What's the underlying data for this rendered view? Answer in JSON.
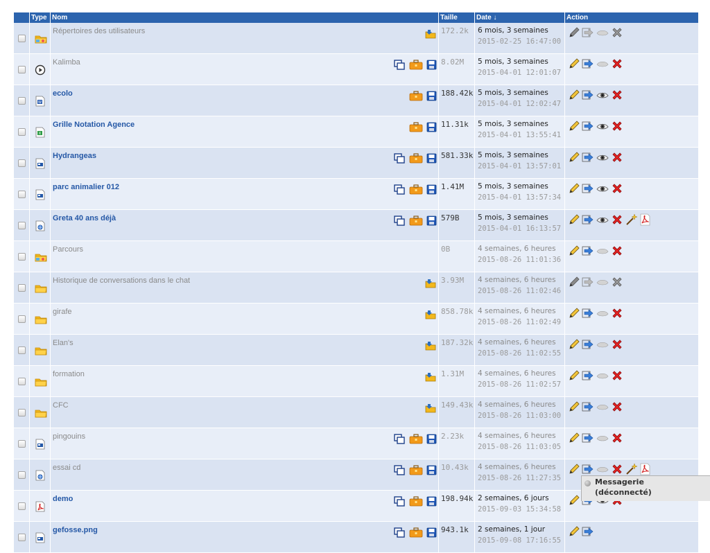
{
  "columns": {
    "type": "Type",
    "name": "Nom",
    "size": "Taille",
    "date": "Date ↓",
    "action": "Action"
  },
  "rows": [
    {
      "name": "Répertoires des utilisateurs",
      "type": "folder-shared",
      "size": "172.2k",
      "rel": "6 mois, 3 semaines",
      "abs": "2015-02-25 16:47:00",
      "style": "dim",
      "tools": [
        "move-icon"
      ],
      "actions": [
        "edit-icon",
        "forward-icon",
        "preview-icon",
        "delete-icon"
      ],
      "disabled": true
    },
    {
      "name": "Kalimba",
      "type": "audio",
      "size": "8.02M",
      "rel": "5 mois, 3 semaines",
      "abs": "2015-04-01 12:01:07",
      "style": "dim",
      "tools": [
        "copy-icon",
        "briefcase-icon",
        "save-icon"
      ],
      "actions": [
        "edit-icon",
        "forward-icon",
        "preview-icon",
        "delete-icon"
      ]
    },
    {
      "name": "ecolo",
      "type": "word",
      "size": "188.42k",
      "rel": "5 mois, 3 semaines",
      "abs": "2015-04-01 12:02:47",
      "style": "link",
      "tools": [
        "briefcase-icon",
        "save-icon"
      ],
      "actions": [
        "edit-icon",
        "forward-icon",
        "view-icon",
        "delete-icon"
      ]
    },
    {
      "name": "Grille Notation Agence",
      "type": "excel",
      "size": "11.31k",
      "rel": "5 mois, 3 semaines",
      "abs": "2015-04-01 13:55:41",
      "style": "link",
      "tools": [
        "briefcase-icon",
        "save-icon"
      ],
      "actions": [
        "edit-icon",
        "forward-icon",
        "view-icon",
        "delete-icon"
      ]
    },
    {
      "name": "Hydrangeas",
      "type": "image",
      "size": "581.33k",
      "rel": "5 mois, 3 semaines",
      "abs": "2015-04-01 13:57:01",
      "style": "link",
      "tools": [
        "copy-icon",
        "briefcase-icon",
        "save-icon"
      ],
      "actions": [
        "edit-icon",
        "forward-icon",
        "view-icon",
        "delete-icon"
      ]
    },
    {
      "name": "parc animalier 012",
      "type": "image",
      "size": "1.41M",
      "rel": "5 mois, 3 semaines",
      "abs": "2015-04-01 13:57:34",
      "style": "link",
      "tools": [
        "copy-icon",
        "briefcase-icon",
        "save-icon"
      ],
      "actions": [
        "edit-icon",
        "forward-icon",
        "view-icon",
        "delete-icon"
      ]
    },
    {
      "name": "Greta 40 ans déjà",
      "type": "web",
      "size": "579B",
      "rel": "5 mois, 3 semaines",
      "abs": "2015-04-01 16:13:57",
      "style": "link",
      "tools": [
        "copy-icon",
        "briefcase-icon",
        "save-icon"
      ],
      "actions": [
        "edit-icon",
        "forward-icon",
        "view-icon",
        "delete-icon",
        "wand-icon",
        "pdf-icon"
      ]
    },
    {
      "name": "Parcours",
      "type": "folder-shared",
      "size": "0B",
      "rel": "4 semaines, 6 heures",
      "abs": "2015-08-26 11:01:36",
      "style": "dim",
      "tools": [],
      "actions": [
        "edit-icon",
        "forward-icon",
        "preview-icon",
        "delete-icon"
      ],
      "dimDate": true
    },
    {
      "name": "Historique de conversations dans le chat",
      "type": "folder",
      "size": "3.93M",
      "rel": "4 semaines, 6 heures",
      "abs": "2015-08-26 11:02:46",
      "style": "dim",
      "tools": [
        "move-icon"
      ],
      "actions": [
        "edit-icon",
        "forward-icon",
        "preview-icon",
        "delete-icon"
      ],
      "disabled": true,
      "dimDate": true
    },
    {
      "name": "girafe",
      "type": "folder",
      "size": "858.78k",
      "rel": "4 semaines, 6 heures",
      "abs": "2015-08-26 11:02:49",
      "style": "dim",
      "tools": [
        "move-icon"
      ],
      "actions": [
        "edit-icon",
        "forward-icon",
        "preview-icon",
        "delete-icon"
      ],
      "dimDate": true
    },
    {
      "name": "Elan's",
      "type": "folder",
      "size": "187.32k",
      "rel": "4 semaines, 6 heures",
      "abs": "2015-08-26 11:02:55",
      "style": "dim",
      "tools": [
        "move-icon"
      ],
      "actions": [
        "edit-icon",
        "forward-icon",
        "preview-icon",
        "delete-icon"
      ],
      "dimDate": true
    },
    {
      "name": "formation",
      "type": "folder",
      "size": "1.31M",
      "rel": "4 semaines, 6 heures",
      "abs": "2015-08-26 11:02:57",
      "style": "dim",
      "tools": [
        "move-icon"
      ],
      "actions": [
        "edit-icon",
        "forward-icon",
        "preview-icon",
        "delete-icon"
      ],
      "dimDate": true
    },
    {
      "name": "CFC",
      "type": "folder",
      "size": "149.43k",
      "rel": "4 semaines, 6 heures",
      "abs": "2015-08-26 11:03:00",
      "style": "dim",
      "tools": [
        "move-icon"
      ],
      "actions": [
        "edit-icon",
        "forward-icon",
        "preview-icon",
        "delete-icon"
      ],
      "dimDate": true
    },
    {
      "name": "pingouins",
      "type": "image",
      "size": "2.23k",
      "rel": "4 semaines, 6 heures",
      "abs": "2015-08-26 11:03:05",
      "style": "dim",
      "tools": [
        "copy-icon",
        "briefcase-icon",
        "save-icon"
      ],
      "actions": [
        "edit-icon",
        "forward-icon",
        "preview-icon",
        "delete-icon"
      ],
      "dimDate": true
    },
    {
      "name": "essai cd",
      "type": "web",
      "size": "10.43k",
      "rel": "4 semaines, 6 heures",
      "abs": "2015-08-26 11:27:35",
      "style": "dim",
      "tools": [
        "copy-icon",
        "briefcase-icon",
        "save-icon"
      ],
      "actions": [
        "edit-icon",
        "forward-icon",
        "preview-icon",
        "delete-icon",
        "wand-icon",
        "pdf-icon"
      ],
      "dimDate": true
    },
    {
      "name": "demo",
      "type": "pdf",
      "size": "198.94k",
      "rel": "2 semaines, 6 jours",
      "abs": "2015-09-03 15:34:58",
      "style": "link",
      "tools": [
        "copy-icon",
        "briefcase-icon",
        "save-icon"
      ],
      "actions": [
        "edit-icon",
        "forward-icon",
        "view-icon",
        "delete-icon"
      ]
    },
    {
      "name": "gefosse.png",
      "type": "image",
      "size": "943.1k",
      "rel": "2 semaines, 1 jour",
      "abs": "2015-09-08 17:16:55",
      "style": "link",
      "tools": [
        "copy-icon",
        "briefcase-icon",
        "save-icon"
      ],
      "actions": [
        "edit-icon",
        "forward-icon"
      ]
    }
  ],
  "messenger": {
    "title": "Messagerie",
    "status": "(déconnecté)"
  }
}
